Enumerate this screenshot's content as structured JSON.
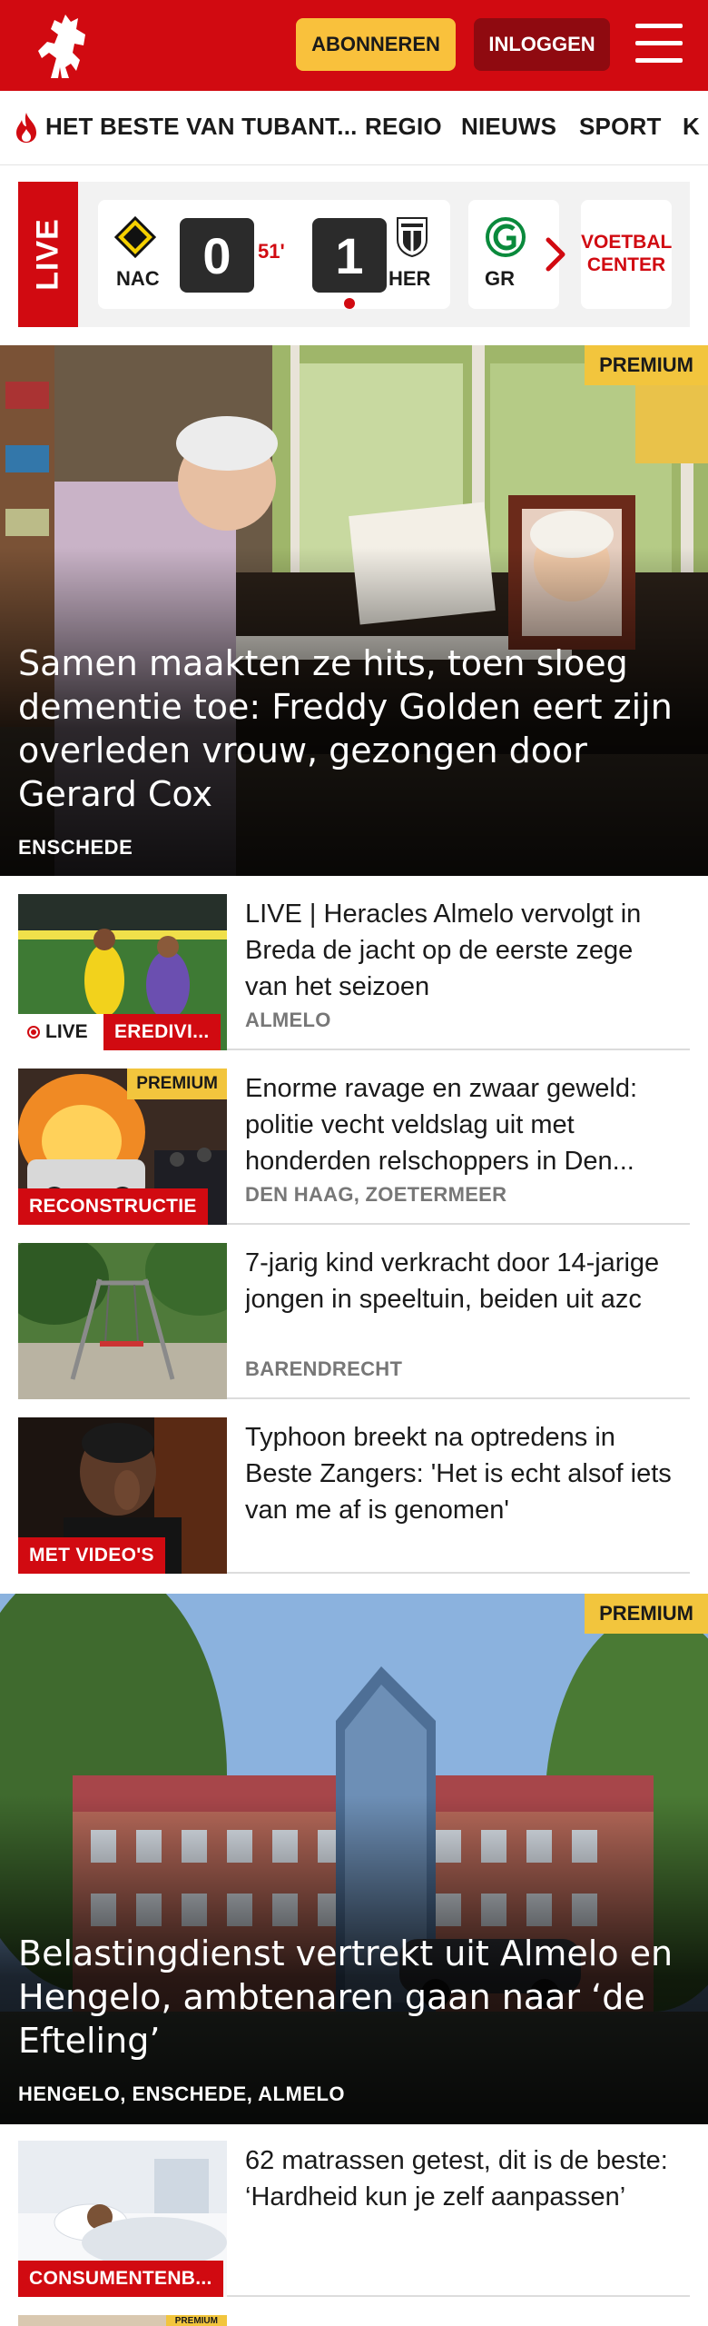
{
  "header": {
    "subscribe_label": "ABONNEREN",
    "login_label": "INLOGGEN"
  },
  "nav": {
    "items": [
      "HET BESTE VAN TUBANT...",
      "REGIO",
      "NIEUWS",
      "SPORT",
      "K"
    ]
  },
  "live": {
    "tag": "LIVE",
    "match": {
      "home": "NAC",
      "home_score": "0",
      "minute": "51'",
      "away_score": "1",
      "away": "HER"
    },
    "next_team": "GR",
    "voetbalcenter_line1": "VOETBAL",
    "voetbalcenter_line2": "CENTER"
  },
  "hero1": {
    "badge": "PREMIUM",
    "title": "Samen maakten ze hits, toen sloeg dementie toe: Freddy Golden eert zijn overleden vrouw, gezongen door Gerard Cox",
    "location": "ENSCHEDE"
  },
  "articles": [
    {
      "title": "LIVE | Heracles Almelo vervolgt in Breda de jacht op de eerste zege van het seizoen",
      "location": "ALMELO",
      "live_label": "LIVE",
      "label": "EREDIVI..."
    },
    {
      "title": "Enorme ravage en zwaar geweld: politie vecht veldslag uit met honderden relschoppers in Den...",
      "location": "DEN HAAG, ZOETERMEER",
      "badge": "PREMIUM",
      "label": "RECONSTRUCTIE"
    },
    {
      "title": "7-jarig kind verkracht door 14-jarige jongen in speeltuin, beiden uit azc",
      "location": "BARENDRECHT"
    },
    {
      "title": "Typhoon breekt na optredens in Beste Zangers: 'Het is echt alsof iets van me af is genomen'",
      "label": "MET VIDEO'S"
    }
  ],
  "hero2": {
    "badge": "PREMIUM",
    "title": "Belastingdienst vertrekt uit Almelo en Hengelo, ambtenaren gaan naar ‘de Efteling’",
    "location": "HENGELO, ENSCHEDE, ALMELO"
  },
  "article5": {
    "title": "62 matrassen getest, dit is de beste: ‘Hardheid kun je zelf aanpassen’",
    "label": "CONSUMENTENB...",
    "next_badge": "PREMIUM"
  },
  "colors": {
    "brand_red": "#d10a11",
    "premium_yellow": "#f2c53d",
    "subscribe_yellow": "#f9c13c"
  },
  "icons": [
    "tubantia-horse-logo",
    "menu-icon",
    "flame-icon",
    "nac-crest-icon",
    "heracles-crest-icon",
    "groningen-crest-icon",
    "chevron-right-icon",
    "live-dot-icon"
  ]
}
